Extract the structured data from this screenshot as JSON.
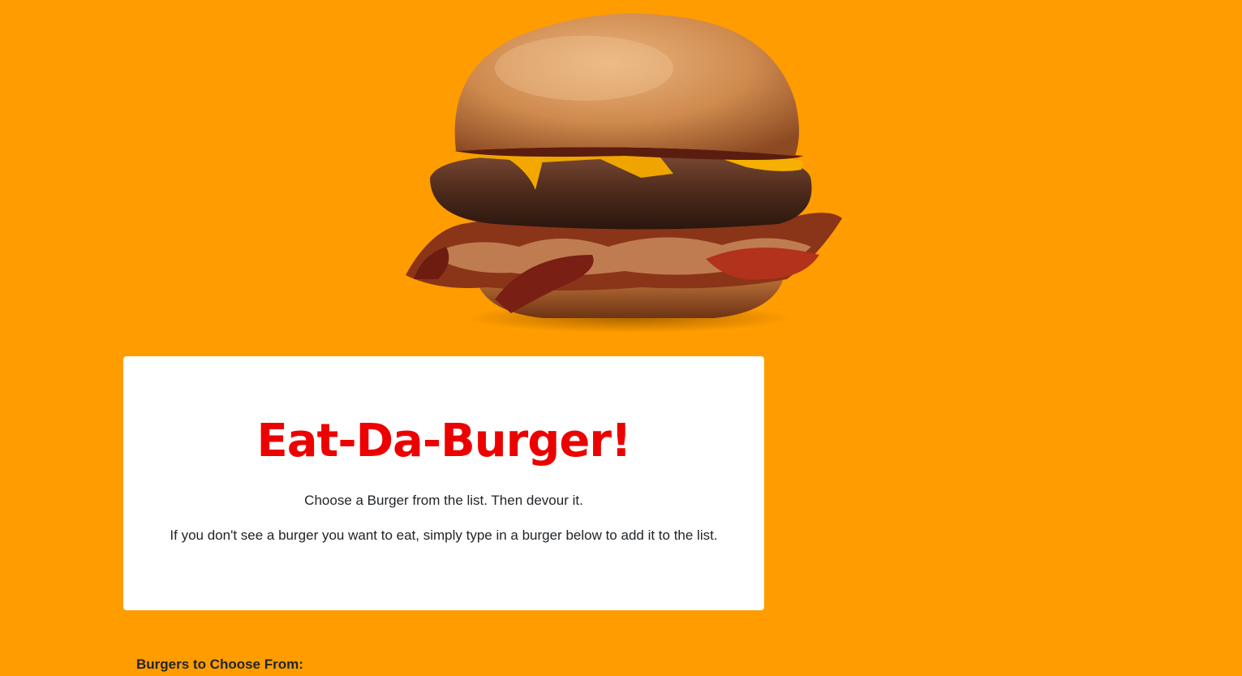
{
  "hero": {
    "image": "cheeseburger-with-bacon-and-onions"
  },
  "jumbotron": {
    "title": "Eat-Da-Burger!",
    "line1": "Choose a Burger from the list. Then devour it.",
    "line2": "If you don't see a burger you want to eat, simply type in a burger below to add it to the list."
  },
  "burgers": {
    "heading": "Burgers to Choose From:"
  },
  "colors": {
    "background": "#ff9c00",
    "title": "#ec0000",
    "card": "#ffffff"
  }
}
